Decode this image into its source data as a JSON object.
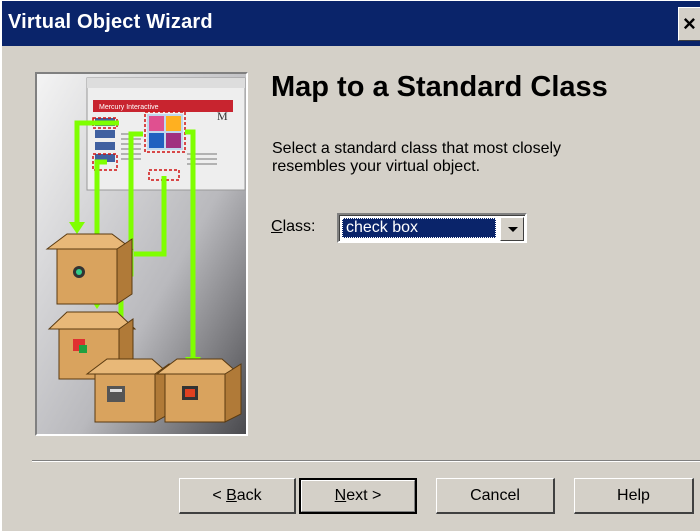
{
  "window": {
    "title": "Virtual Object Wizard",
    "close_symbol": "×"
  },
  "illustration": {
    "banner_text": "Mercury Interactive",
    "logo_text": "M",
    "icon": "class-mapping-illustration"
  },
  "heading": "Map to a Standard Class",
  "description": "Select a standard class that most closely resembles your virtual object.",
  "class_field": {
    "label_underlined": "C",
    "label_rest": "lass:",
    "value": "check box"
  },
  "buttons": {
    "back_prefix": "< ",
    "back_underlined": "B",
    "back_rest": "ack",
    "next_underlined": "N",
    "next_rest": "ext >",
    "cancel": "Cancel",
    "help": "Help"
  },
  "colors": {
    "titlebar": "#0a246a",
    "face": "#d4d0c8",
    "arrows": "#7fff00",
    "boxes": "#d9a35e",
    "selection": "#0a246a"
  }
}
